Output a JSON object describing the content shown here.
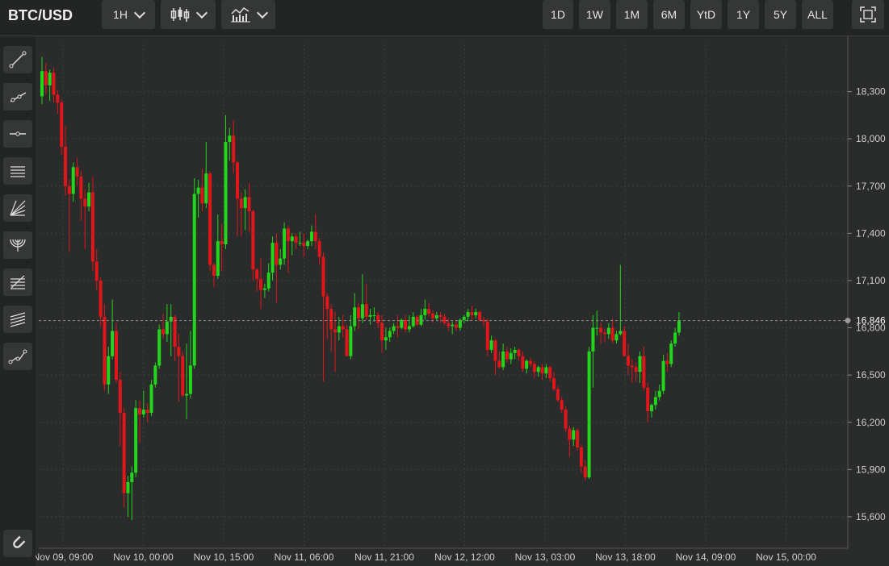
{
  "header": {
    "symbol": "BTC/USD",
    "interval": "1H",
    "ranges": [
      "1D",
      "1W",
      "1M",
      "6M",
      "YtD",
      "1Y",
      "5Y",
      "ALL"
    ]
  },
  "sidebar_tools": [
    "trend-line-icon",
    "ray-icon",
    "horizontal-line-icon",
    "parallel-channel-icon",
    "fan-icon",
    "arc-icon",
    "fibonacci-retracement-icon",
    "fibonacci-extension-icon",
    "polyline-icon",
    "magnet-icon"
  ],
  "colors": {
    "up": "#22d61b",
    "down": "#e0161b",
    "grid": "#3c3d3d",
    "axis": "#cfcfcf",
    "last_price_line": "#8a8a8a"
  },
  "chart_data": {
    "type": "candlestick",
    "symbol": "BTC/USD",
    "interval": "1H",
    "ylim": [
      15400,
      18600
    ],
    "y_ticks": [
      15600,
      15900,
      16200,
      16500,
      16800,
      17100,
      17400,
      17700,
      18000,
      18300
    ],
    "y_tick_labels": [
      "15,600",
      "15,900",
      "16,200",
      "16,500",
      "16,800",
      "17,100",
      "17,400",
      "17,700",
      "18,000",
      "18,300"
    ],
    "x_labels": [
      "Nov 09, 09:00",
      "Nov 10, 00:00",
      "Nov 10, 15:00",
      "Nov 11, 06:00",
      "Nov 11, 21:00",
      "Nov 12, 12:00",
      "Nov 13, 03:00",
      "Nov 13, 18:00",
      "Nov 14, 09:00",
      "Nov 15, 00:00"
    ],
    "last_price": 16846,
    "last_price_label": "16,846",
    "candles": [
      {
        "o": 18270,
        "h": 18520,
        "l": 18220,
        "c": 18430
      },
      {
        "o": 18430,
        "h": 18480,
        "l": 18280,
        "c": 18340
      },
      {
        "o": 18340,
        "h": 18440,
        "l": 18240,
        "c": 18420
      },
      {
        "o": 18420,
        "h": 18450,
        "l": 18230,
        "c": 18280
      },
      {
        "o": 18280,
        "h": 18310,
        "l": 18160,
        "c": 18230
      },
      {
        "o": 18230,
        "h": 18250,
        "l": 17900,
        "c": 17950
      },
      {
        "o": 17950,
        "h": 18080,
        "l": 17640,
        "c": 17700
      },
      {
        "o": 17700,
        "h": 17740,
        "l": 17280,
        "c": 17650
      },
      {
        "o": 17650,
        "h": 17850,
        "l": 17600,
        "c": 17820
      },
      {
        "o": 17820,
        "h": 17880,
        "l": 17700,
        "c": 17760
      },
      {
        "o": 17760,
        "h": 17800,
        "l": 17480,
        "c": 17620
      },
      {
        "o": 17620,
        "h": 17680,
        "l": 17300,
        "c": 17570
      },
      {
        "o": 17570,
        "h": 17720,
        "l": 17540,
        "c": 17660
      },
      {
        "o": 17660,
        "h": 17760,
        "l": 17160,
        "c": 17220
      },
      {
        "o": 17220,
        "h": 17300,
        "l": 17040,
        "c": 17100
      },
      {
        "o": 17100,
        "h": 17120,
        "l": 16810,
        "c": 16870
      },
      {
        "o": 16870,
        "h": 16950,
        "l": 16400,
        "c": 16440
      },
      {
        "o": 16440,
        "h": 16680,
        "l": 16380,
        "c": 16620
      },
      {
        "o": 16620,
        "h": 16980,
        "l": 16600,
        "c": 16780
      },
      {
        "o": 16780,
        "h": 16830,
        "l": 16450,
        "c": 16470
      },
      {
        "o": 16470,
        "h": 16520,
        "l": 16050,
        "c": 16260
      },
      {
        "o": 16260,
        "h": 16290,
        "l": 15660,
        "c": 15750
      },
      {
        "o": 15750,
        "h": 15860,
        "l": 15600,
        "c": 15820
      },
      {
        "o": 15820,
        "h": 15920,
        "l": 15580,
        "c": 15880
      },
      {
        "o": 15880,
        "h": 16340,
        "l": 15850,
        "c": 16290
      },
      {
        "o": 16290,
        "h": 16340,
        "l": 16070,
        "c": 16250
      },
      {
        "o": 16250,
        "h": 16400,
        "l": 16230,
        "c": 16280
      },
      {
        "o": 16280,
        "h": 16320,
        "l": 16200,
        "c": 16260
      },
      {
        "o": 16260,
        "h": 16470,
        "l": 16240,
        "c": 16440
      },
      {
        "o": 16440,
        "h": 16580,
        "l": 16420,
        "c": 16560
      },
      {
        "o": 16560,
        "h": 16820,
        "l": 16540,
        "c": 16790
      },
      {
        "o": 16790,
        "h": 16890,
        "l": 16730,
        "c": 16760
      },
      {
        "o": 16760,
        "h": 16950,
        "l": 16710,
        "c": 16840
      },
      {
        "o": 16840,
        "h": 16950,
        "l": 16620,
        "c": 16870
      },
      {
        "o": 16870,
        "h": 16880,
        "l": 16590,
        "c": 16680
      },
      {
        "o": 16680,
        "h": 16760,
        "l": 16330,
        "c": 16620
      },
      {
        "o": 16620,
        "h": 16650,
        "l": 16360,
        "c": 16370
      },
      {
        "o": 16370,
        "h": 16700,
        "l": 16220,
        "c": 16380
      },
      {
        "o": 16380,
        "h": 16780,
        "l": 16350,
        "c": 16560
      },
      {
        "o": 16560,
        "h": 17750,
        "l": 16540,
        "c": 17650
      },
      {
        "o": 17650,
        "h": 17740,
        "l": 17500,
        "c": 17690
      },
      {
        "o": 17690,
        "h": 17810,
        "l": 17540,
        "c": 17590
      },
      {
        "o": 17590,
        "h": 17980,
        "l": 17560,
        "c": 17780
      },
      {
        "o": 17780,
        "h": 17790,
        "l": 17160,
        "c": 17200
      },
      {
        "o": 17200,
        "h": 17210,
        "l": 17060,
        "c": 17130
      },
      {
        "o": 17130,
        "h": 17520,
        "l": 17110,
        "c": 17350
      },
      {
        "o": 17350,
        "h": 17460,
        "l": 17160,
        "c": 17330
      },
      {
        "o": 17330,
        "h": 18150,
        "l": 17300,
        "c": 17980
      },
      {
        "o": 17980,
        "h": 18070,
        "l": 17860,
        "c": 18020
      },
      {
        "o": 18020,
        "h": 18120,
        "l": 17780,
        "c": 17850
      },
      {
        "o": 17850,
        "h": 17860,
        "l": 17380,
        "c": 17620
      },
      {
        "o": 17620,
        "h": 17660,
        "l": 17380,
        "c": 17560
      },
      {
        "o": 17560,
        "h": 17680,
        "l": 17420,
        "c": 17630
      },
      {
        "o": 17630,
        "h": 17720,
        "l": 17410,
        "c": 17540
      },
      {
        "o": 17540,
        "h": 17550,
        "l": 17100,
        "c": 17170
      },
      {
        "o": 17170,
        "h": 17180,
        "l": 17030,
        "c": 17110
      },
      {
        "o": 17110,
        "h": 17240,
        "l": 16920,
        "c": 17040
      },
      {
        "o": 17040,
        "h": 17080,
        "l": 16990,
        "c": 17050
      },
      {
        "o": 17050,
        "h": 17210,
        "l": 17030,
        "c": 17150
      },
      {
        "o": 17150,
        "h": 17380,
        "l": 17100,
        "c": 17340
      },
      {
        "o": 17340,
        "h": 17400,
        "l": 16960,
        "c": 17200
      },
      {
        "o": 17200,
        "h": 17300,
        "l": 17170,
        "c": 17240
      },
      {
        "o": 17240,
        "h": 17470,
        "l": 17200,
        "c": 17430
      },
      {
        "o": 17430,
        "h": 17450,
        "l": 17150,
        "c": 17350
      },
      {
        "o": 17350,
        "h": 17400,
        "l": 17260,
        "c": 17380
      },
      {
        "o": 17380,
        "h": 17400,
        "l": 17300,
        "c": 17340
      },
      {
        "o": 17340,
        "h": 17410,
        "l": 17320,
        "c": 17340
      },
      {
        "o": 17340,
        "h": 17400,
        "l": 17250,
        "c": 17320
      },
      {
        "o": 17320,
        "h": 17360,
        "l": 17300,
        "c": 17350
      },
      {
        "o": 17350,
        "h": 17450,
        "l": 17320,
        "c": 17410
      },
      {
        "o": 17410,
        "h": 17520,
        "l": 17300,
        "c": 17350
      },
      {
        "o": 17350,
        "h": 17370,
        "l": 17200,
        "c": 17250
      },
      {
        "o": 17250,
        "h": 17280,
        "l": 16460,
        "c": 17000
      },
      {
        "o": 17000,
        "h": 17020,
        "l": 16730,
        "c": 16920
      },
      {
        "o": 16920,
        "h": 16950,
        "l": 16650,
        "c": 16790
      },
      {
        "o": 16790,
        "h": 16900,
        "l": 16520,
        "c": 16770
      },
      {
        "o": 16770,
        "h": 16870,
        "l": 16720,
        "c": 16810
      },
      {
        "o": 16810,
        "h": 16880,
        "l": 16740,
        "c": 16790
      },
      {
        "o": 16790,
        "h": 16820,
        "l": 16620,
        "c": 16620
      },
      {
        "o": 16620,
        "h": 16880,
        "l": 16600,
        "c": 16810
      },
      {
        "o": 16810,
        "h": 17020,
        "l": 16780,
        "c": 16930
      },
      {
        "o": 16930,
        "h": 16960,
        "l": 16790,
        "c": 16860
      },
      {
        "o": 16860,
        "h": 17140,
        "l": 16830,
        "c": 16950
      },
      {
        "o": 16950,
        "h": 17080,
        "l": 16850,
        "c": 16870
      },
      {
        "o": 16870,
        "h": 16920,
        "l": 16820,
        "c": 16880
      },
      {
        "o": 16880,
        "h": 16930,
        "l": 16840,
        "c": 16880
      },
      {
        "o": 16880,
        "h": 16900,
        "l": 16800,
        "c": 16830
      },
      {
        "o": 16830,
        "h": 16880,
        "l": 16640,
        "c": 16720
      },
      {
        "o": 16720,
        "h": 16800,
        "l": 16660,
        "c": 16740
      },
      {
        "o": 16740,
        "h": 16800,
        "l": 16710,
        "c": 16780
      },
      {
        "o": 16780,
        "h": 16830,
        "l": 16760,
        "c": 16810
      },
      {
        "o": 16810,
        "h": 16880,
        "l": 16740,
        "c": 16800
      },
      {
        "o": 16800,
        "h": 16860,
        "l": 16790,
        "c": 16850
      },
      {
        "o": 16850,
        "h": 16880,
        "l": 16770,
        "c": 16790
      },
      {
        "o": 16790,
        "h": 16880,
        "l": 16770,
        "c": 16810
      },
      {
        "o": 16810,
        "h": 16900,
        "l": 16800,
        "c": 16870
      },
      {
        "o": 16870,
        "h": 16880,
        "l": 16810,
        "c": 16820
      },
      {
        "o": 16820,
        "h": 16920,
        "l": 16810,
        "c": 16880
      },
      {
        "o": 16880,
        "h": 16980,
        "l": 16850,
        "c": 16920
      },
      {
        "o": 16920,
        "h": 16960,
        "l": 16870,
        "c": 16890
      },
      {
        "o": 16890,
        "h": 16910,
        "l": 16830,
        "c": 16860
      },
      {
        "o": 16860,
        "h": 16900,
        "l": 16850,
        "c": 16880
      },
      {
        "o": 16880,
        "h": 16900,
        "l": 16830,
        "c": 16870
      },
      {
        "o": 16870,
        "h": 16890,
        "l": 16820,
        "c": 16830
      },
      {
        "o": 16830,
        "h": 16860,
        "l": 16780,
        "c": 16810
      },
      {
        "o": 16810,
        "h": 16840,
        "l": 16760,
        "c": 16820
      },
      {
        "o": 16820,
        "h": 16850,
        "l": 16780,
        "c": 16800
      },
      {
        "o": 16800,
        "h": 16860,
        "l": 16780,
        "c": 16850
      },
      {
        "o": 16850,
        "h": 16880,
        "l": 16830,
        "c": 16870
      },
      {
        "o": 16870,
        "h": 16920,
        "l": 16840,
        "c": 16900
      },
      {
        "o": 16900,
        "h": 16940,
        "l": 16850,
        "c": 16880
      },
      {
        "o": 16880,
        "h": 16920,
        "l": 16860,
        "c": 16900
      },
      {
        "o": 16900,
        "h": 16910,
        "l": 16840,
        "c": 16850
      },
      {
        "o": 16850,
        "h": 16870,
        "l": 16810,
        "c": 16840
      },
      {
        "o": 16840,
        "h": 16860,
        "l": 16620,
        "c": 16660
      },
      {
        "o": 16660,
        "h": 16750,
        "l": 16640,
        "c": 16720
      },
      {
        "o": 16720,
        "h": 16730,
        "l": 16500,
        "c": 16590
      },
      {
        "o": 16590,
        "h": 16650,
        "l": 16540,
        "c": 16550
      },
      {
        "o": 16550,
        "h": 16700,
        "l": 16530,
        "c": 16650
      },
      {
        "o": 16650,
        "h": 16680,
        "l": 16580,
        "c": 16600
      },
      {
        "o": 16600,
        "h": 16670,
        "l": 16570,
        "c": 16640
      },
      {
        "o": 16640,
        "h": 16680,
        "l": 16600,
        "c": 16660
      },
      {
        "o": 16660,
        "h": 16670,
        "l": 16590,
        "c": 16620
      },
      {
        "o": 16620,
        "h": 16650,
        "l": 16520,
        "c": 16540
      },
      {
        "o": 16540,
        "h": 16600,
        "l": 16510,
        "c": 16590
      },
      {
        "o": 16590,
        "h": 16610,
        "l": 16550,
        "c": 16570
      },
      {
        "o": 16570,
        "h": 16590,
        "l": 16480,
        "c": 16520
      },
      {
        "o": 16520,
        "h": 16560,
        "l": 16490,
        "c": 16550
      },
      {
        "o": 16550,
        "h": 16570,
        "l": 16470,
        "c": 16510
      },
      {
        "o": 16510,
        "h": 16570,
        "l": 16480,
        "c": 16550
      },
      {
        "o": 16550,
        "h": 16560,
        "l": 16460,
        "c": 16480
      },
      {
        "o": 16480,
        "h": 16520,
        "l": 16400,
        "c": 16410
      },
      {
        "o": 16410,
        "h": 16430,
        "l": 16330,
        "c": 16340
      },
      {
        "o": 16340,
        "h": 16360,
        "l": 16260,
        "c": 16280
      },
      {
        "o": 16280,
        "h": 16300,
        "l": 16140,
        "c": 16160
      },
      {
        "o": 16160,
        "h": 16180,
        "l": 15980,
        "c": 16090
      },
      {
        "o": 16090,
        "h": 16170,
        "l": 16050,
        "c": 16150
      },
      {
        "o": 16150,
        "h": 16160,
        "l": 16020,
        "c": 16040
      },
      {
        "o": 16040,
        "h": 16060,
        "l": 15880,
        "c": 15920
      },
      {
        "o": 15920,
        "h": 15960,
        "l": 15830,
        "c": 15850
      },
      {
        "o": 15850,
        "h": 16680,
        "l": 15840,
        "c": 16650
      },
      {
        "o": 16650,
        "h": 16880,
        "l": 16420,
        "c": 16800
      },
      {
        "o": 16800,
        "h": 16910,
        "l": 16750,
        "c": 16800
      },
      {
        "o": 16800,
        "h": 16830,
        "l": 16700,
        "c": 16770
      },
      {
        "o": 16770,
        "h": 16790,
        "l": 16710,
        "c": 16760
      },
      {
        "o": 16760,
        "h": 16830,
        "l": 16730,
        "c": 16800
      },
      {
        "o": 16800,
        "h": 16860,
        "l": 16700,
        "c": 16720
      },
      {
        "o": 16720,
        "h": 16780,
        "l": 16700,
        "c": 16760
      },
      {
        "o": 16760,
        "h": 17200,
        "l": 16750,
        "c": 16780
      },
      {
        "o": 16780,
        "h": 16810,
        "l": 16620,
        "c": 16620
      },
      {
        "o": 16620,
        "h": 16700,
        "l": 16500,
        "c": 16560
      },
      {
        "o": 16560,
        "h": 16600,
        "l": 16450,
        "c": 16550
      },
      {
        "o": 16550,
        "h": 16580,
        "l": 16460,
        "c": 16520
      },
      {
        "o": 16520,
        "h": 16650,
        "l": 16450,
        "c": 16620
      },
      {
        "o": 16620,
        "h": 16680,
        "l": 16400,
        "c": 16420
      },
      {
        "o": 16420,
        "h": 16450,
        "l": 16200,
        "c": 16270
      },
      {
        "o": 16270,
        "h": 16320,
        "l": 16230,
        "c": 16310
      },
      {
        "o": 16310,
        "h": 16400,
        "l": 16280,
        "c": 16360
      },
      {
        "o": 16360,
        "h": 16440,
        "l": 16340,
        "c": 16400
      },
      {
        "o": 16400,
        "h": 16630,
        "l": 16380,
        "c": 16590
      },
      {
        "o": 16590,
        "h": 16640,
        "l": 16520,
        "c": 16570
      },
      {
        "o": 16570,
        "h": 16720,
        "l": 16550,
        "c": 16700
      },
      {
        "o": 16700,
        "h": 16800,
        "l": 16680,
        "c": 16770
      },
      {
        "o": 16770,
        "h": 16900,
        "l": 16750,
        "c": 16846
      }
    ]
  }
}
